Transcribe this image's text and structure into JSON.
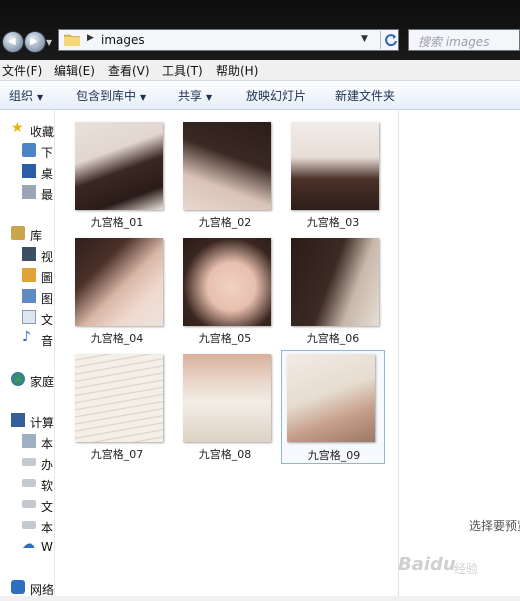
{
  "address": {
    "path": "images"
  },
  "search": {
    "placeholder": "搜索 images"
  },
  "menu": [
    "文件(F)",
    "编辑(E)",
    "查看(V)",
    "工具(T)",
    "帮助(H)"
  ],
  "toolbar": {
    "organize": "组织",
    "include_in_library": "包含到库中",
    "share": "共享",
    "slideshow": "放映幻灯片",
    "new_folder": "新建文件夹"
  },
  "nav": {
    "favorites": "收藏",
    "fav_items": [
      "下",
      "桌",
      "最"
    ],
    "libraries": "库",
    "lib_items": [
      "视",
      "圖",
      "图",
      "文",
      "音"
    ],
    "homegroup": "家庭",
    "computer": "计算",
    "comp_items": [
      "本",
      "办",
      "软",
      "文",
      "本",
      "W"
    ],
    "network": "网络"
  },
  "files": [
    "九宫格_01",
    "九宫格_02",
    "九宫格_03",
    "九宫格_04",
    "九宫格_05",
    "九宫格_06",
    "九宫格_07",
    "九宫格_08",
    "九宫格_09"
  ],
  "preview": {
    "hint": "选择要预览"
  },
  "watermark": {
    "text": "Baidu",
    "sub": "经验"
  }
}
